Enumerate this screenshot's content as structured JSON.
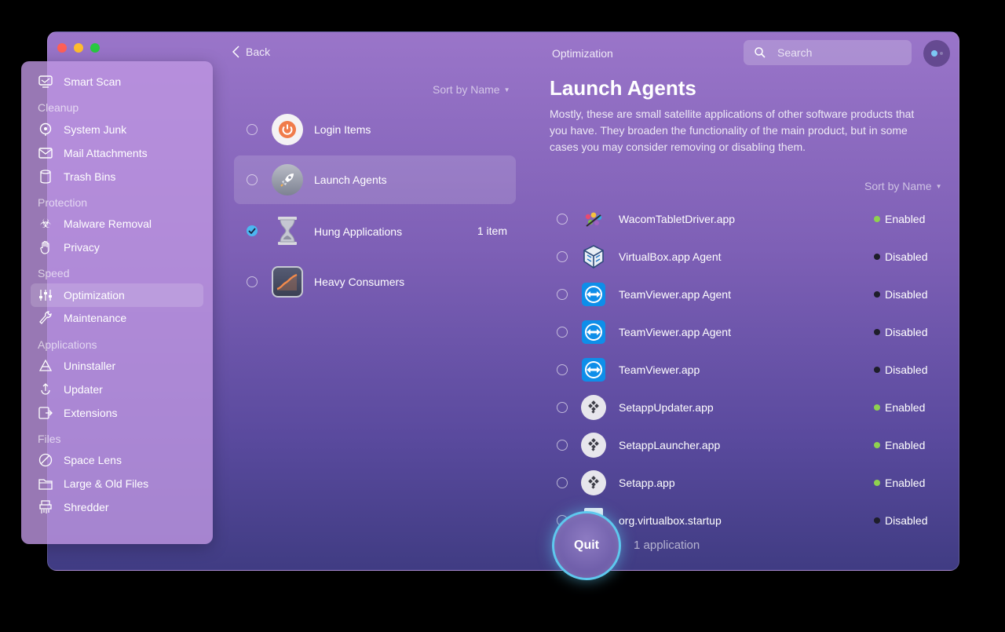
{
  "header": {
    "back_label": "Back",
    "title": "Optimization",
    "search_placeholder": "Search"
  },
  "sidebar": {
    "top": {
      "label": "Smart Scan",
      "icon": "smart-scan-icon"
    },
    "sections": [
      {
        "title": "Cleanup",
        "items": [
          {
            "label": "System Junk",
            "icon": "system-junk-icon"
          },
          {
            "label": "Mail Attachments",
            "icon": "mail-icon"
          },
          {
            "label": "Trash Bins",
            "icon": "trash-icon"
          }
        ]
      },
      {
        "title": "Protection",
        "items": [
          {
            "label": "Malware Removal",
            "icon": "biohazard-icon"
          },
          {
            "label": "Privacy",
            "icon": "hand-icon"
          }
        ]
      },
      {
        "title": "Speed",
        "items": [
          {
            "label": "Optimization",
            "icon": "sliders-icon",
            "active": true
          },
          {
            "label": "Maintenance",
            "icon": "wrench-icon"
          }
        ]
      },
      {
        "title": "Applications",
        "items": [
          {
            "label": "Uninstaller",
            "icon": "uninstaller-icon"
          },
          {
            "label": "Updater",
            "icon": "updater-icon"
          },
          {
            "label": "Extensions",
            "icon": "extensions-icon"
          }
        ]
      },
      {
        "title": "Files",
        "items": [
          {
            "label": "Space Lens",
            "icon": "space-lens-icon"
          },
          {
            "label": "Large & Old Files",
            "icon": "folder-icon"
          },
          {
            "label": "Shredder",
            "icon": "shredder-icon"
          }
        ]
      }
    ]
  },
  "middle": {
    "sort_label": "Sort by Name",
    "categories": [
      {
        "label": "Login Items",
        "icon": "power-icon",
        "checked": false,
        "count": ""
      },
      {
        "label": "Launch Agents",
        "icon": "rocket-icon",
        "checked": false,
        "count": "",
        "selected": true
      },
      {
        "label": "Hung Applications",
        "icon": "hourglass-icon",
        "checked": true,
        "count": "1 item"
      },
      {
        "label": "Heavy Consumers",
        "icon": "chart-icon",
        "checked": false,
        "count": ""
      }
    ]
  },
  "detail": {
    "title": "Launch Agents",
    "description": "Mostly, these are small satellite applications of other software products that you have. They broaden the functionality of the main product, but in some cases you may consider removing or disabling them.",
    "sort_label": "Sort by Name",
    "agents": [
      {
        "name": "WacomTabletDriver.app",
        "status": "Enabled",
        "icon": "wacom-icon"
      },
      {
        "name": "VirtualBox.app Agent",
        "status": "Disabled",
        "icon": "virtualbox-icon"
      },
      {
        "name": "TeamViewer.app Agent",
        "status": "Disabled",
        "icon": "teamviewer-icon"
      },
      {
        "name": "TeamViewer.app Agent",
        "status": "Disabled",
        "icon": "teamviewer-icon"
      },
      {
        "name": "TeamViewer.app",
        "status": "Disabled",
        "icon": "teamviewer-icon"
      },
      {
        "name": "SetappUpdater.app",
        "status": "Enabled",
        "icon": "setapp-icon"
      },
      {
        "name": "SetappLauncher.app",
        "status": "Enabled",
        "icon": "setapp-icon"
      },
      {
        "name": "Setapp.app",
        "status": "Enabled",
        "icon": "setapp-icon"
      },
      {
        "name": "org.virtualbox.startup",
        "status": "Disabled",
        "icon": "document-icon"
      }
    ]
  },
  "footer": {
    "quit_label": "Quit",
    "selection_text": "1 application"
  },
  "colors": {
    "enabled": "#8fd14f",
    "disabled": "#1e1e2a",
    "accent": "#4cb6f0"
  }
}
